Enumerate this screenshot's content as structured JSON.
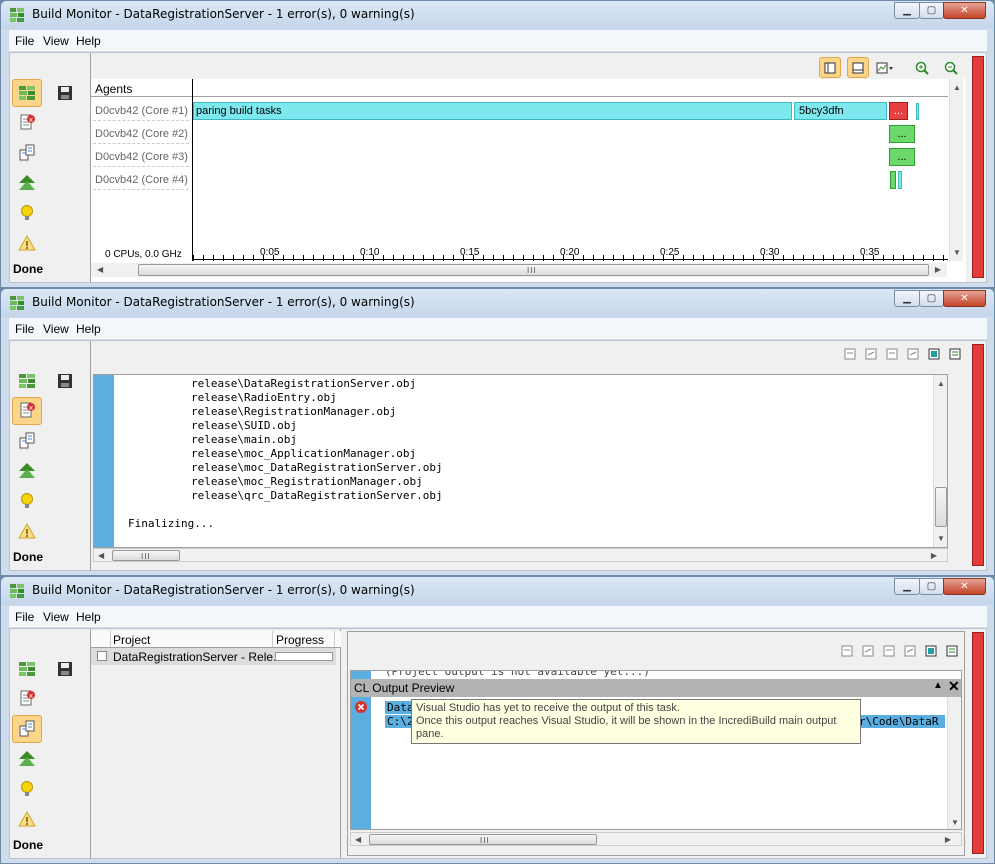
{
  "window_title": "Build Monitor - DataRegistrationServer - 1 error(s), 0 warning(s)",
  "menu": [
    "File",
    "View",
    "Help"
  ],
  "status": "Done",
  "timeline": {
    "header": "Agents",
    "agents": [
      "D0cvb42 (Core #1)",
      "D0cvb42 (Core #2)",
      "D0cvb42 (Core #3)",
      "D0cvb42 (Core #4)"
    ],
    "task1": "paring build tasks",
    "task2": "5bcy3dfn",
    "dots": "...",
    "cpu_info": "0 CPUs, 0.0 GHz",
    "ticks": [
      "0:05",
      "0:10",
      "0:15",
      "0:20",
      "0:25",
      "0:30",
      "0:35"
    ],
    "colors": {
      "task": "#7ee8ef",
      "error": "#e84040",
      "ok": "#6cd86c"
    }
  },
  "output": {
    "lines": [
      "release\\DataRegistrationServer.obj",
      "release\\RadioEntry.obj",
      "release\\RegistrationManager.obj",
      "release\\SUID.obj",
      "release\\main.obj",
      "release\\moc_ApplicationManager.obj",
      "release\\moc_DataRegistrationServer.obj",
      "release\\moc_RegistrationManager.obj",
      "release\\qrc_DataRegistrationServer.obj"
    ],
    "finalizing": "Finalizing..."
  },
  "projects": {
    "col_project": "Project",
    "col_progress": "Progress",
    "row": "DataRegistrationServer - Rele...",
    "hidden_line": "(Project output is not available yet...)",
    "preview_title": "CL Output Preview",
    "preview_line1": "DataR",
    "preview_line2": "C:\\2",
    "preview_line2_tail": "r\\Code\\DataR",
    "tooltip_line1": "Visual Studio has yet to receive the output of this task.",
    "tooltip_line2": "Once this output reaches Visual Studio, it will be shown in the IncrediBuild main output pane."
  }
}
